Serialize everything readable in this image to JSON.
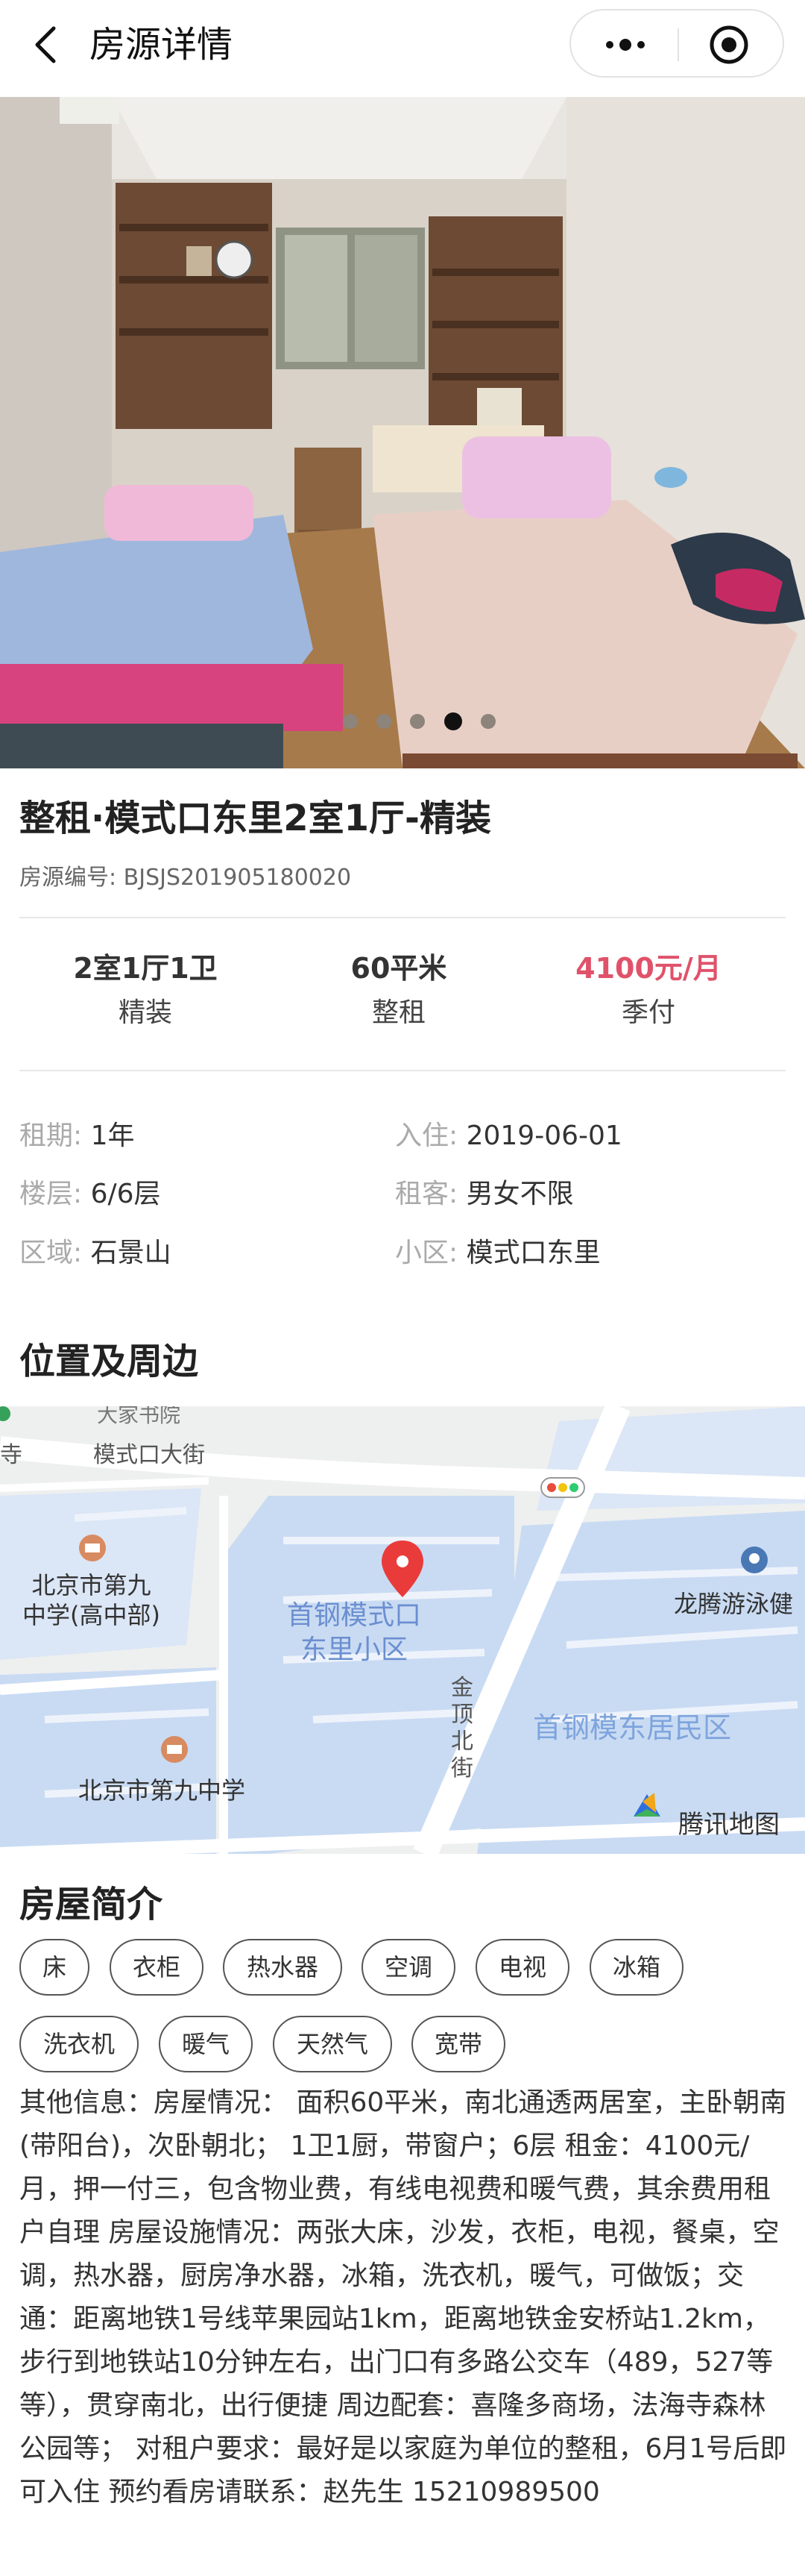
{
  "navbar": {
    "title": "房源详情"
  },
  "photo": {
    "slides_total": 5,
    "active_slide": 4
  },
  "listing": {
    "title": "整租·模式口东里2室1厅-精装",
    "house_no": "房源编号: BJSJS201905180020"
  },
  "stats": [
    {
      "value": "2室1厅1卫",
      "sub": "精装"
    },
    {
      "value": "60平米",
      "sub": "整租"
    },
    {
      "value": "4100元/月",
      "sub": "季付"
    }
  ],
  "info": {
    "lease_key": "租期:",
    "lease_val": "1年",
    "movein_key": "入住:",
    "movein_val": "2019-06-01",
    "floor_key": "楼层:",
    "floor_val": "6/6层",
    "tenant_key": "租客:",
    "tenant_val": "男女不限",
    "district_key": "区域:",
    "district_val": "石景山",
    "community_key": "小区:",
    "community_val": "模式口东里"
  },
  "location": {
    "section_title": "位置及周边",
    "map": {
      "labels": {
        "street_top": "模式口大街",
        "top_left_partial": "大家书院",
        "left_partial": "慧寺",
        "school1_line1": "北京市第九",
        "school1_line2": "中学(高中部)",
        "pin_line1": "首钢模式口",
        "pin_line2": "东里小区",
        "pool": "龙腾游泳健",
        "road": "金顶北街",
        "residential": "首钢模东居民区",
        "school2": "北京市第九中学",
        "brand": "腾讯地图"
      }
    }
  },
  "intro": {
    "section_title": "房屋简介",
    "tags": [
      "床",
      "衣柜",
      "热水器",
      "空调",
      "电视",
      "冰箱",
      "洗衣机",
      "暖气",
      "天然气",
      "宽带"
    ],
    "description": "其他信息：房屋情况： 面积60平米，南北通透两居室，主卧朝南(带阳台)，次卧朝北； 1卫1厨，带窗户；6层 租金：4100元/月，押一付三，包含物业费，有线电视费和暖气费，其余费用租户自理 房屋设施情况：两张大床，沙发，衣柜，电视，餐桌，空调，热水器，厨房净水器，冰箱，洗衣机，暖气，可做饭；交通：距离地铁1号线苹果园站1km，距离地铁金安桥站1.2km，步行到地铁站10分钟左右，出门口有多路公交车（489，527等等），贯穿南北，出行便捷 周边配套：喜隆多商场，法海寺森林公园等； 对租户要求：最好是以家庭为单位的整租，6月1号后即可入住 预约看房请联系：赵先生 15210989500"
  },
  "colors": {
    "price": "#e0526a",
    "map_block": "#c9dbf3",
    "map_bg": "#eef0ef",
    "pin": "#ea3b3b"
  }
}
